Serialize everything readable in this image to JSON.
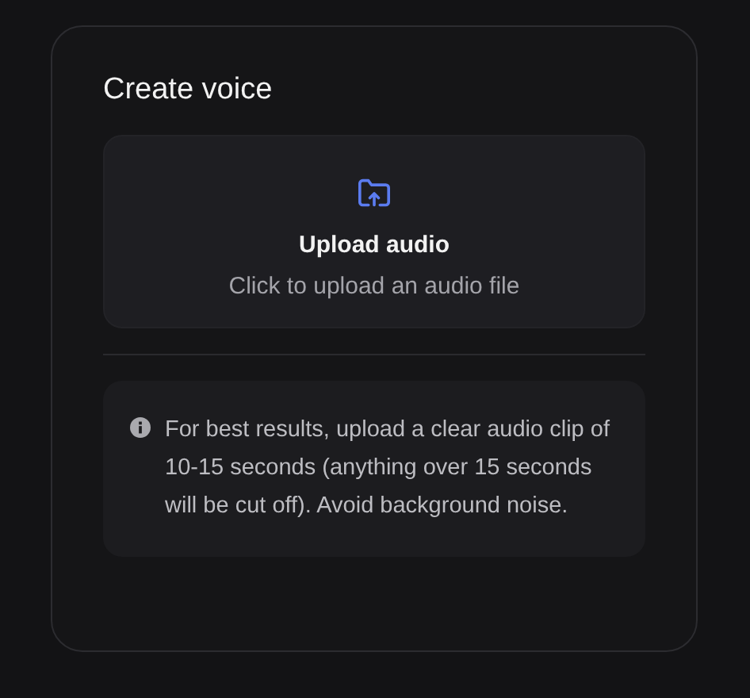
{
  "card": {
    "title": "Create voice"
  },
  "upload": {
    "title": "Upload audio",
    "subtitle": "Click to upload an audio file"
  },
  "info": {
    "text": "For best results, upload a clear audio clip of 10-15 seconds (anything over 15 seconds will be cut off). Avoid background noise."
  }
}
